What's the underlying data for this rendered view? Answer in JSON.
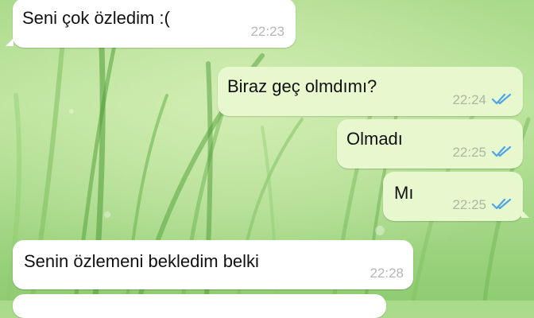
{
  "chat": {
    "messages": [
      {
        "text": "Seni çok özledim :(",
        "time": "22:23",
        "direction": "incoming"
      },
      {
        "text": "Biraz geç olmdımı?",
        "time": "22:24",
        "direction": "outgoing",
        "status": "read-double-check"
      },
      {
        "text": "Olmadı",
        "time": "22:25",
        "direction": "outgoing",
        "status": "read-double-check"
      },
      {
        "text": "Mı",
        "time": "22:25",
        "direction": "outgoing",
        "status": "read-double-check"
      },
      {
        "text": "Senin özlemeni bekledim belki",
        "time": "22:28",
        "direction": "incoming"
      }
    ]
  },
  "colors": {
    "incoming_bubble": "#ffffff",
    "outgoing_bubble": "#e7f8cf",
    "read_check": "#4fa3e6",
    "wallpaper": "#a9d98a"
  },
  "icons": {
    "read_receipt": "double-check-icon"
  }
}
